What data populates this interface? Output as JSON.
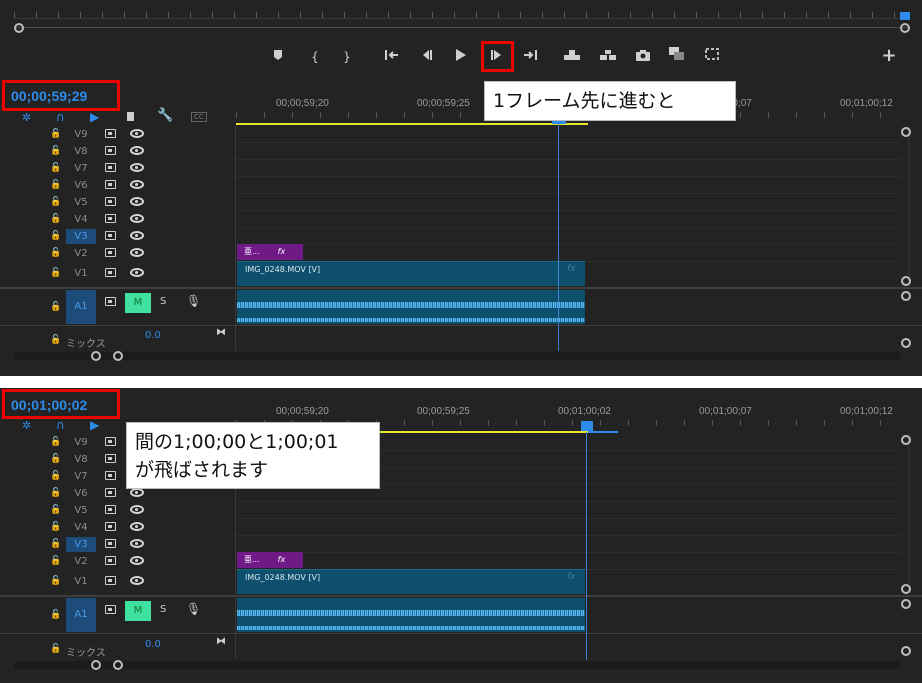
{
  "colors": {
    "accent": "#2d8ceb",
    "highlight_red": "#e00000",
    "mute_green": "#3fe0a0",
    "clip_video": "#0e4f6e",
    "clip_fx": "#6f1a86",
    "inout_yellow": "#e6e62a"
  },
  "top_panel": {
    "timecode": "00;00;59;29",
    "callout": "1フレーム先に進むと",
    "ruler_labels": [
      "00;00;59;20",
      "00;00;59;25",
      "00;01;00;07",
      "00;01;00;12"
    ],
    "playhead_position": 0.65
  },
  "bottom_panel": {
    "timecode": "00;01;00;02",
    "callout_line1": "間の1;00;00と1;00;01",
    "callout_line2": "が飛ばされます",
    "ruler_labels": [
      "00;00;59;20",
      "00;00;59;25",
      "00;01;00;02",
      "00;01;00;07",
      "00;01;00;12"
    ],
    "playhead_position": 0.79
  },
  "transport": {
    "icons": [
      "add-marker-icon",
      "mark-in-icon",
      "mark-out-icon",
      "go-to-in-icon",
      "step-back-icon",
      "play-icon",
      "step-forward-icon",
      "go-to-out-icon",
      "lift-icon",
      "extract-icon",
      "export-frame-icon",
      "comparison-view-icon",
      "vr-video-icon",
      "add-button-icon"
    ],
    "selected": "step-forward-icon"
  },
  "tracks": {
    "video": [
      "V9",
      "V8",
      "V7",
      "V6",
      "V5",
      "V4",
      "V3",
      "V2",
      "V1"
    ],
    "selected_video": "V3",
    "audio": "A1",
    "mute": "M",
    "solo": "S",
    "mix_label": "ミックス",
    "mix_value": "0.0"
  },
  "clips": {
    "video_name": "IMG_0248.MOV [V]",
    "fx_label": "fx",
    "adj_label": "亜..."
  }
}
